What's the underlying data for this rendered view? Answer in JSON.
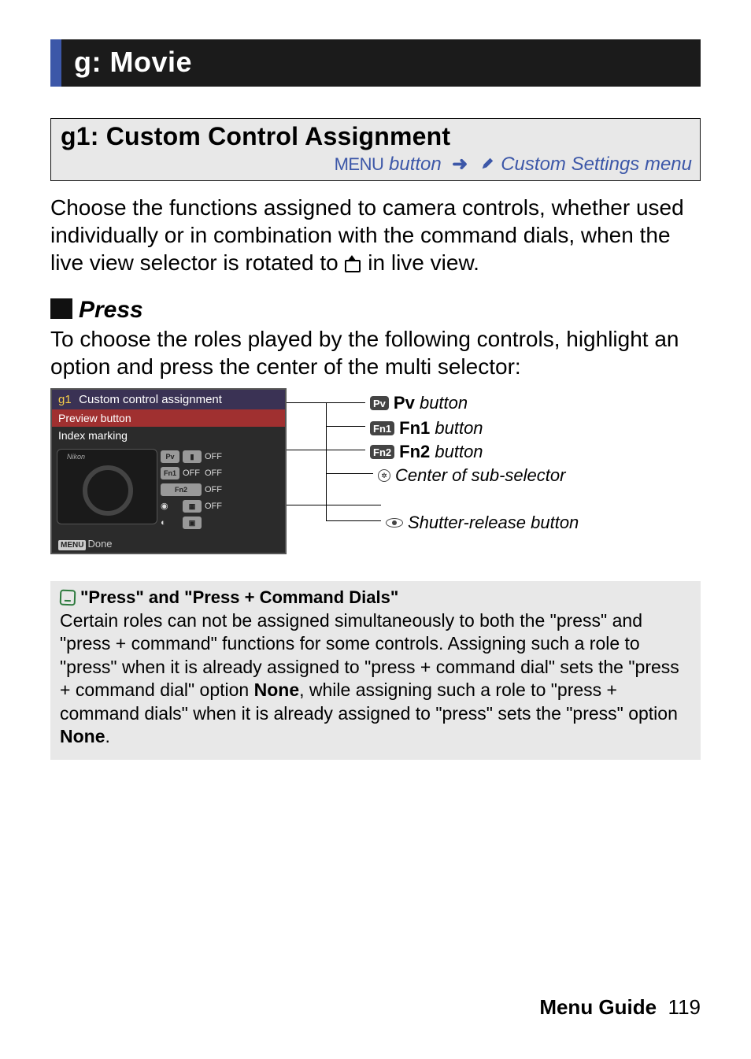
{
  "section": {
    "title": "g: Movie"
  },
  "subsection": {
    "title": "g1: Custom Control Assignment",
    "menu_label": "MENU",
    "button_word": "button",
    "menu_name": "Custom Settings menu"
  },
  "intro": "Choose the functions assigned to camera controls, whether used individually or in combination with the command dials, when the live view selector is rotated to ",
  "intro_tail": " in live view.",
  "press_heading": "Press",
  "press_body": "To choose the roles played by the following controls, highlight an option and press the center of the multi selector:",
  "lcd": {
    "header_prefix": "g1",
    "header_title": "Custom control assignment",
    "selected": "Preview button",
    "subline": "Index marking",
    "rows": [
      {
        "icon1": "Pv",
        "icon2": "▮",
        "right": "OFF"
      },
      {
        "icon1": "Fn1",
        "icon2": "OFF",
        "right": "OFF"
      },
      {
        "icon1": "Fn2",
        "icon2": "OFF",
        "right": ""
      },
      {
        "icon1": "◉",
        "icon2": "▦",
        "right": "OFF"
      },
      {
        "icon1": "◐",
        "icon2": "▣",
        "right": ""
      }
    ],
    "footer_badge": "MENU",
    "footer_text": "Done"
  },
  "callouts": {
    "pv": {
      "label_bold": "Pv",
      "label_rest": "button"
    },
    "fn1": {
      "label_bold": "Fn1",
      "label_rest": "button"
    },
    "fn2": {
      "label_bold": "Fn2",
      "label_rest": "button"
    },
    "sub": {
      "label": "Center of sub-selector"
    },
    "shutter": {
      "label": "Shutter-release button"
    }
  },
  "note": {
    "title": "\"Press\" and \"Press + Command Dials\"",
    "body_a": "Certain roles can not be assigned simultaneously to both the \"press\" and \"press + command\" functions for some controls.  Assigning such a role to \"press\" when it is already assigned to \"press + command dial\" sets the \"press + command dial\" option ",
    "none1": "None",
    "body_b": ", while assigning such a role to \"press + command dials\" when it is already assigned to \"press\" sets the \"press\" option ",
    "none2": "None",
    "body_c": "."
  },
  "footer": {
    "label": "Menu Guide",
    "page": "119"
  }
}
